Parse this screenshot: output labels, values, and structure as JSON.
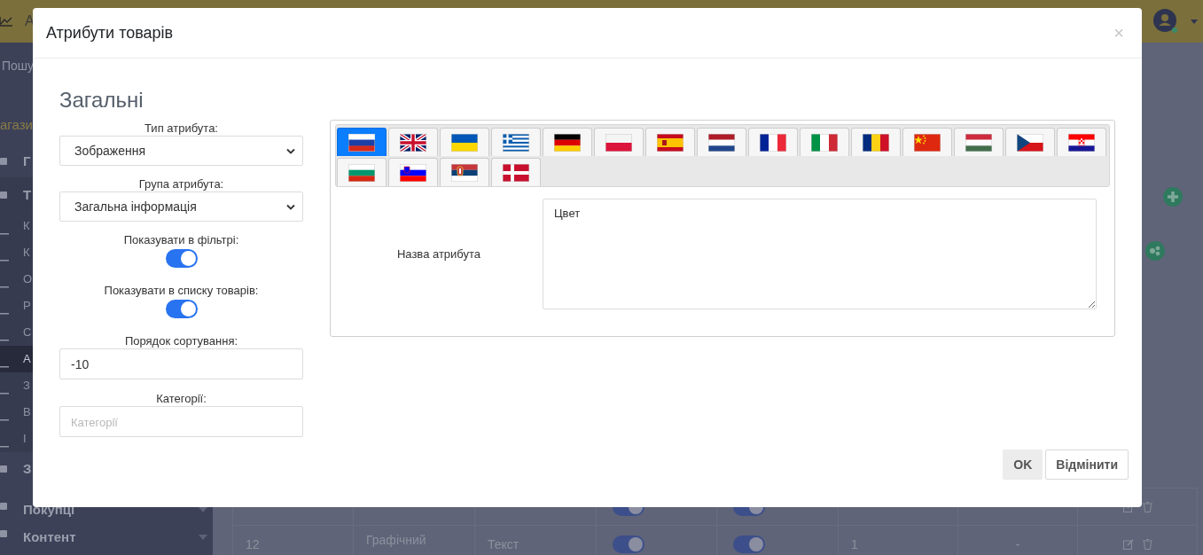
{
  "topbar": {
    "brand": "А"
  },
  "sidebar": {
    "search": "Пошу",
    "store": "агази",
    "items": [
      {
        "label": "Г",
        "kind": "section",
        "selected": false
      },
      {
        "label": "Т",
        "kind": "section",
        "selected": false
      },
      {
        "label": "К",
        "kind": "sub",
        "selected": false
      },
      {
        "label": "К",
        "kind": "sub",
        "selected": false
      },
      {
        "label": "О",
        "kind": "sub",
        "selected": false
      },
      {
        "label": "Р",
        "kind": "sub",
        "selected": false
      },
      {
        "label": "С",
        "kind": "sub",
        "selected": false
      },
      {
        "label": "А",
        "kind": "sub",
        "selected": true
      },
      {
        "label": "З",
        "kind": "sub",
        "selected": false
      },
      {
        "label": "В",
        "kind": "sub",
        "selected": false
      },
      {
        "label": "І",
        "kind": "sub",
        "selected": false
      },
      {
        "label": "З",
        "kind": "section",
        "selected": false
      },
      {
        "label": "Покупці",
        "kind": "menu",
        "selected": false
      },
      {
        "label": "Контент",
        "kind": "menu",
        "selected": false
      }
    ]
  },
  "table": {
    "rows": [
      {
        "filter_on": true,
        "list_on": true
      },
      {
        "id": "12",
        "name": "Графічний",
        "type": "Текст",
        "order": "1",
        "categories": "-",
        "filter_on": true,
        "list_on": true
      }
    ]
  },
  "modal": {
    "title": "Атрибути товарів",
    "close": "×",
    "section": "Загальні",
    "fields": [
      {
        "kind": "select",
        "label": "Тип атрибута:",
        "value": "Зображення"
      },
      {
        "kind": "select",
        "label": "Група атрибута:",
        "value": "Загальна інформація"
      },
      {
        "kind": "toggle",
        "label": "Показувати в фільтрі:",
        "on": true
      },
      {
        "kind": "toggle",
        "label": "Показувати в списку товарів:",
        "on": true
      },
      {
        "kind": "input",
        "label": "Порядок сортування:",
        "value": "-10"
      },
      {
        "kind": "input",
        "label": "Категорії:",
        "placeholder": "Категорії"
      }
    ],
    "languages": [
      {
        "kind": "ru",
        "selected": true
      },
      {
        "kind": "gb",
        "selected": false
      },
      {
        "kind": "ua",
        "selected": false
      },
      {
        "kind": "gr",
        "selected": false
      },
      {
        "kind": "de",
        "selected": false
      },
      {
        "kind": "pl",
        "selected": false
      },
      {
        "kind": "es",
        "selected": false
      },
      {
        "kind": "nl",
        "selected": false
      },
      {
        "kind": "fr",
        "selected": false
      },
      {
        "kind": "it",
        "selected": false
      },
      {
        "kind": "ro",
        "selected": false
      },
      {
        "kind": "cn",
        "selected": false
      },
      {
        "kind": "hu",
        "selected": false
      },
      {
        "kind": "cz",
        "selected": false
      },
      {
        "kind": "hr",
        "selected": false
      },
      {
        "kind": "bg",
        "selected": false
      },
      {
        "kind": "si",
        "selected": false
      },
      {
        "kind": "rs",
        "selected": false
      },
      {
        "kind": "dk",
        "selected": false
      }
    ],
    "name_label": "Назва атрибута",
    "name_value": "Цвет",
    "buttons": [
      {
        "label": "OK",
        "kind": "primary"
      },
      {
        "label": "Відмінити",
        "kind": "secondary"
      }
    ]
  }
}
